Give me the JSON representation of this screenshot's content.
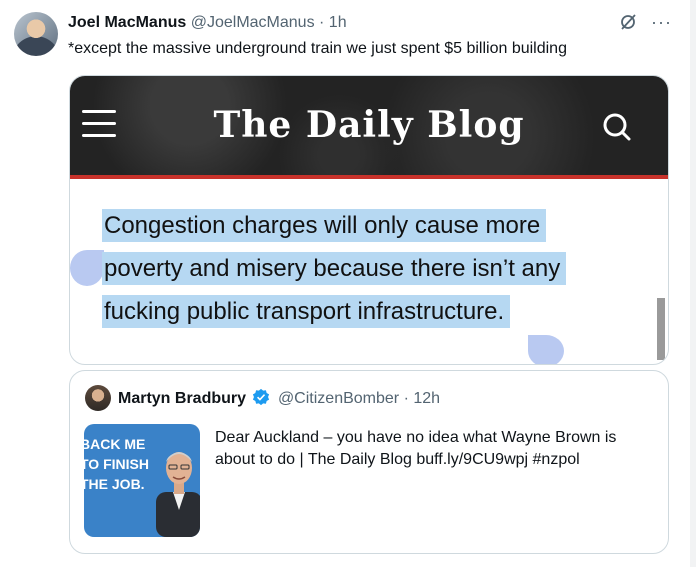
{
  "tweet": {
    "author_name": "Joel MacManus",
    "author_handle": "@JoelMacManus",
    "separator": "·",
    "time": "1h",
    "more_label": "···",
    "text": "*except the massive underground train we just spent $5 billion building"
  },
  "media": {
    "blog_title": "The Daily Blog",
    "quote": "Congestion charges will only cause more poverty and misery because there isn’t any fucking public transport infrastructure."
  },
  "quoted": {
    "author_name": "Martyn Bradbury",
    "author_handle": "@CitizenBomber",
    "separator": "·",
    "time": "12h",
    "text": "Dear Auckland – you have no idea what Wayne Brown is about to do | The Daily Blog buff.ly/9CU9wpj #nzpol",
    "thumb_text": "BACK ME TO FINISH THE JOB."
  },
  "colors": {
    "selection": "#b6d8f2",
    "verified": "#1d9bf0",
    "blog_accent": "#c8322b"
  }
}
